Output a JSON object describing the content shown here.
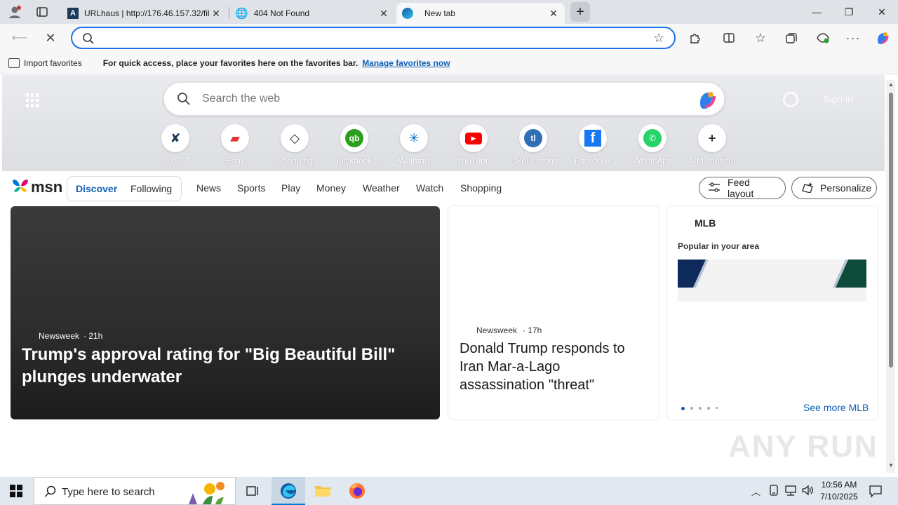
{
  "tabs": [
    {
      "title": "URLhaus | http://176.46.157.32/fil"
    },
    {
      "title": "404 Not Found"
    },
    {
      "title": "New tab"
    }
  ],
  "favorites_bar": {
    "import_label": "Import favorites",
    "message": "For quick access, place your favorites here on the favorites bar.",
    "link": "Manage favorites now"
  },
  "newtab": {
    "search_placeholder": "Search the web",
    "sign_in": "Sign in",
    "shortcuts": [
      {
        "label": "TaxACT",
        "icon": "taxact-icon",
        "color": "#1b3a57"
      },
      {
        "label": "Ebay",
        "icon": "ebay-bag-icon",
        "color": "#e53238"
      },
      {
        "label": "Shopping",
        "icon": "tag-icon",
        "color": "#333333"
      },
      {
        "label": "Quickbooks",
        "icon": "quickbooks-icon",
        "color": "#2ca01c"
      },
      {
        "label": "Walmart",
        "icon": "walmart-spark-icon",
        "color": "#0071ce"
      },
      {
        "label": "YouTube",
        "icon": "youtube-icon",
        "color": "#ff0000"
      },
      {
        "label": "TakeLessons",
        "icon": "takelessons-icon",
        "color": "#2f6fb6"
      },
      {
        "label": "Facebook",
        "icon": "facebook-icon",
        "color": "#1877f2"
      },
      {
        "label": "WhatsApp",
        "icon": "whatsapp-icon",
        "color": "#25d366"
      },
      {
        "label": "Add shortcut",
        "icon": "plus-icon",
        "color": "#333333"
      }
    ]
  },
  "msn": {
    "logo": "msn",
    "tabs": [
      "Discover",
      "Following"
    ],
    "nav": [
      "News",
      "Sports",
      "Play",
      "Money",
      "Weather",
      "Watch",
      "Shopping"
    ],
    "feed_layout": "Feed layout",
    "personalize": "Personalize"
  },
  "cards": {
    "main": {
      "source": "Newsweek",
      "age": "· 21h",
      "headline": "Trump's approval rating for \"Big Beautiful Bill\" plunges underwater"
    },
    "second": {
      "source": "Newsweek",
      "age": "· 17h",
      "headline": "Donald Trump responds to Iran Mar-a-Lago assassination \"threat\""
    },
    "mlb": {
      "title": "MLB",
      "subtitle": "Popular in your area",
      "see_more": "See more MLB"
    }
  },
  "watermark": "ANY RUN",
  "taskbar": {
    "search_placeholder": "Type here to search",
    "time": "10:56 AM",
    "date": "7/10/2025"
  }
}
